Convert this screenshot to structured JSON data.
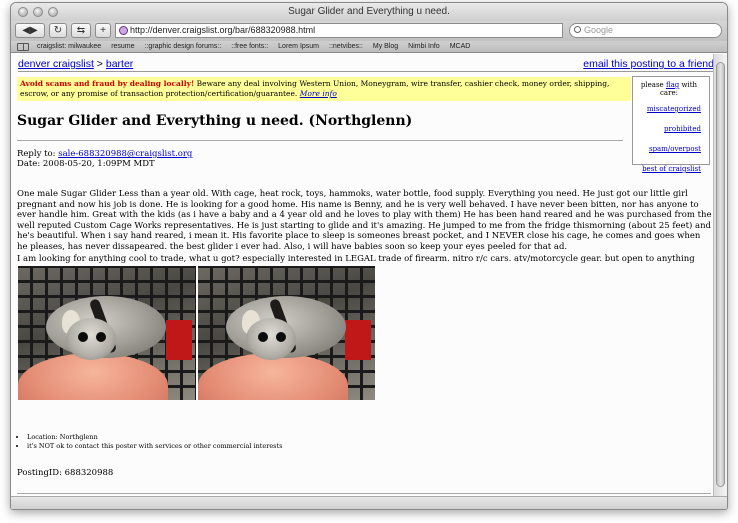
{
  "browser": {
    "window_title": "Sugar Glider and Everything u need.",
    "url": "http://denver.craigslist.org/bar/688320988.html",
    "search_placeholder": "Google",
    "bookmarks": [
      "craigslist: milwaukee",
      "resume",
      "::graphic design forums::",
      "::free fonts::",
      "Lorem Ipsum",
      "::netvibes::",
      "My Blog",
      "Nimbi Info",
      "MCAD"
    ]
  },
  "page": {
    "breadcrumb": {
      "site": "denver craigslist",
      "separator": ">",
      "category": "barter"
    },
    "email_link": "email this posting to a friend",
    "scam_warning": {
      "bold": "Avoid scams and fraud by dealing locally!",
      "text": " Beware any deal involving Western Union, Moneygram, wire transfer, cashier check, money order, shipping, escrow, or any promise of transaction protection/certification/guarantee.",
      "link": "More info"
    },
    "flag_box": {
      "prefix": "please",
      "flag_link": "flag",
      "suffix": "with care:",
      "items": [
        "miscategorized",
        "prohibited",
        "spam/overpost",
        "best of craigslist"
      ]
    },
    "title": "Sugar Glider and Everything u need. (Northglenn)",
    "reply_label": "Reply to:",
    "reply_email": "sale-688320988@craigslist.org",
    "date_line": "Date: 2008-05-20, 1:09PM MDT",
    "body_paragraph_1": "One male Sugar Glider Less than a year old. With cage, heat rock, toys, hammoks, water bottle, food supply. Everything you need. He just got our little girl pregnant and now his job is done. He is looking for a good home. His name is Benny, and he is very well behaved. I have never been bitten, nor has anyone to ever handle him. Great with the kids (as i have a baby and a 4 year old and he loves to play with them) He has been hand reared and he was purchased from the well reputed Custom Cage Works representatives. He is just starting to glide and it's amazing. He jumped to me from the fridge thismorning (about 25 feet) and he's beautiful. When i say hand reared, i mean it. His favorite place to sleep is someones breast pocket, and I NEVER close his cage, he comes and goes when he pleases, has never dissapeared. the best glider i ever had. Also, i will have babies soon so keep your eyes peeled for that ad.",
    "body_paragraph_2": "I am looking for anything cool to trade, what u got? especially interested in LEGAL trade of firearm. nitro r/c cars. atv/motorcycle gear. but open to anything",
    "details": [
      "Location: Northglenn",
      "it's NOT ok to contact this poster with services or other commercial interests"
    ],
    "posting_id": "PostingID: 688320988"
  }
}
